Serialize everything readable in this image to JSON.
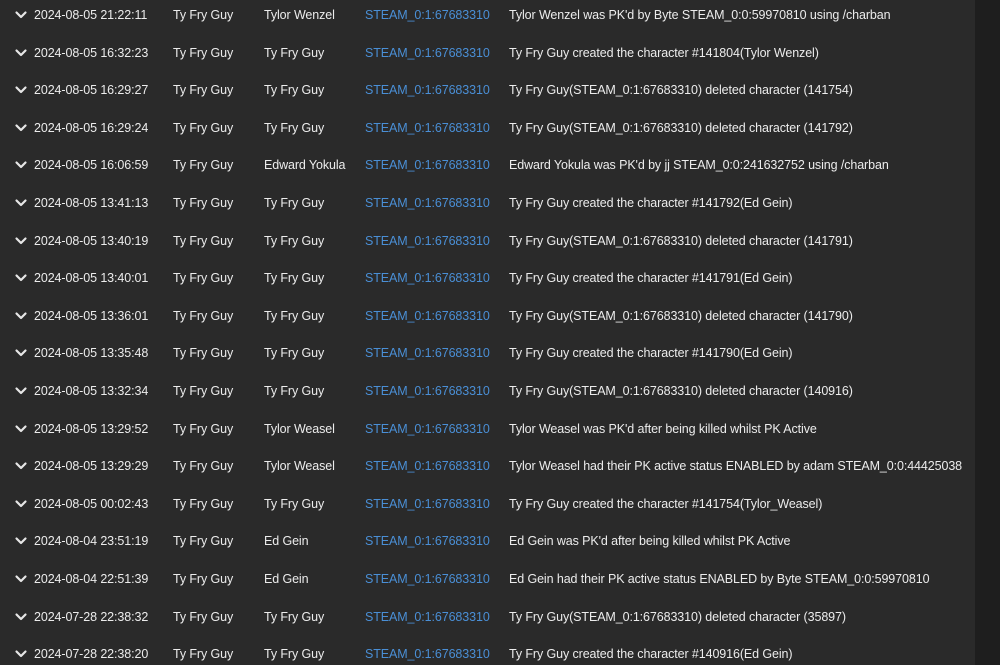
{
  "log_rows": [
    {
      "date": "2024-08-05 21:22:11",
      "player": "Ty Fry Guy",
      "character": "Tylor Wenzel",
      "steam_id": "STEAM_0:1:67683310",
      "message": "Tylor Wenzel was PK'd by Byte STEAM_0:0:59970810 using /charban"
    },
    {
      "date": "2024-08-05 16:32:23",
      "player": "Ty Fry Guy",
      "character": "Ty Fry Guy",
      "steam_id": "STEAM_0:1:67683310",
      "message": "Ty Fry Guy created the character #141804(Tylor Wenzel)"
    },
    {
      "date": "2024-08-05 16:29:27",
      "player": "Ty Fry Guy",
      "character": "Ty Fry Guy",
      "steam_id": "STEAM_0:1:67683310",
      "message": "Ty Fry Guy(STEAM_0:1:67683310) deleted character (141754)"
    },
    {
      "date": "2024-08-05 16:29:24",
      "player": "Ty Fry Guy",
      "character": "Ty Fry Guy",
      "steam_id": "STEAM_0:1:67683310",
      "message": "Ty Fry Guy(STEAM_0:1:67683310) deleted character (141792)"
    },
    {
      "date": "2024-08-05 16:06:59",
      "player": "Ty Fry Guy",
      "character": "Edward Yokula",
      "steam_id": "STEAM_0:1:67683310",
      "message": "Edward Yokula was PK'd by jj STEAM_0:0:241632752 using /charban"
    },
    {
      "date": "2024-08-05 13:41:13",
      "player": "Ty Fry Guy",
      "character": "Ty Fry Guy",
      "steam_id": "STEAM_0:1:67683310",
      "message": "Ty Fry Guy created the character #141792(Ed Gein)"
    },
    {
      "date": "2024-08-05 13:40:19",
      "player": "Ty Fry Guy",
      "character": "Ty Fry Guy",
      "steam_id": "STEAM_0:1:67683310",
      "message": "Ty Fry Guy(STEAM_0:1:67683310) deleted character (141791)"
    },
    {
      "date": "2024-08-05 13:40:01",
      "player": "Ty Fry Guy",
      "character": "Ty Fry Guy",
      "steam_id": "STEAM_0:1:67683310",
      "message": "Ty Fry Guy created the character #141791(Ed Gein)"
    },
    {
      "date": "2024-08-05 13:36:01",
      "player": "Ty Fry Guy",
      "character": "Ty Fry Guy",
      "steam_id": "STEAM_0:1:67683310",
      "message": "Ty Fry Guy(STEAM_0:1:67683310) deleted character (141790)"
    },
    {
      "date": "2024-08-05 13:35:48",
      "player": "Ty Fry Guy",
      "character": "Ty Fry Guy",
      "steam_id": "STEAM_0:1:67683310",
      "message": "Ty Fry Guy created the character #141790(Ed Gein)"
    },
    {
      "date": "2024-08-05 13:32:34",
      "player": "Ty Fry Guy",
      "character": "Ty Fry Guy",
      "steam_id": "STEAM_0:1:67683310",
      "message": "Ty Fry Guy(STEAM_0:1:67683310) deleted character (140916)"
    },
    {
      "date": "2024-08-05 13:29:52",
      "player": "Ty Fry Guy",
      "character": "Tylor Weasel",
      "steam_id": "STEAM_0:1:67683310",
      "message": "Tylor Weasel was PK'd after being killed whilst PK Active"
    },
    {
      "date": "2024-08-05 13:29:29",
      "player": "Ty Fry Guy",
      "character": "Tylor Weasel",
      "steam_id": "STEAM_0:1:67683310",
      "message": "Tylor Weasel had their PK active status ENABLED by adam STEAM_0:0:44425038"
    },
    {
      "date": "2024-08-05 00:02:43",
      "player": "Ty Fry Guy",
      "character": "Ty Fry Guy",
      "steam_id": "STEAM_0:1:67683310",
      "message": "Ty Fry Guy created the character #141754(Tylor_Weasel)"
    },
    {
      "date": "2024-08-04 23:51:19",
      "player": "Ty Fry Guy",
      "character": "Ed Gein",
      "steam_id": "STEAM_0:1:67683310",
      "message": "Ed Gein was PK'd after being killed whilst PK Active"
    },
    {
      "date": "2024-08-04 22:51:39",
      "player": "Ty Fry Guy",
      "character": "Ed Gein",
      "steam_id": "STEAM_0:1:67683310",
      "message": "Ed Gein had their PK active status ENABLED by Byte STEAM_0:0:59970810"
    },
    {
      "date": "2024-07-28 22:38:32",
      "player": "Ty Fry Guy",
      "character": "Ty Fry Guy",
      "steam_id": "STEAM_0:1:67683310",
      "message": "Ty Fry Guy(STEAM_0:1:67683310) deleted character (35897)"
    },
    {
      "date": "2024-07-28 22:38:20",
      "player": "Ty Fry Guy",
      "character": "Ty Fry Guy",
      "steam_id": "STEAM_0:1:67683310",
      "message": "Ty Fry Guy created the character #140916(Ed Gein)"
    }
  ],
  "row_icon": "chevron-down-icon",
  "colors": {
    "background": "#2a2a2a",
    "gutter": "#1e1e1e",
    "text": "#ececec",
    "steam_link": "#4a8fd6"
  }
}
